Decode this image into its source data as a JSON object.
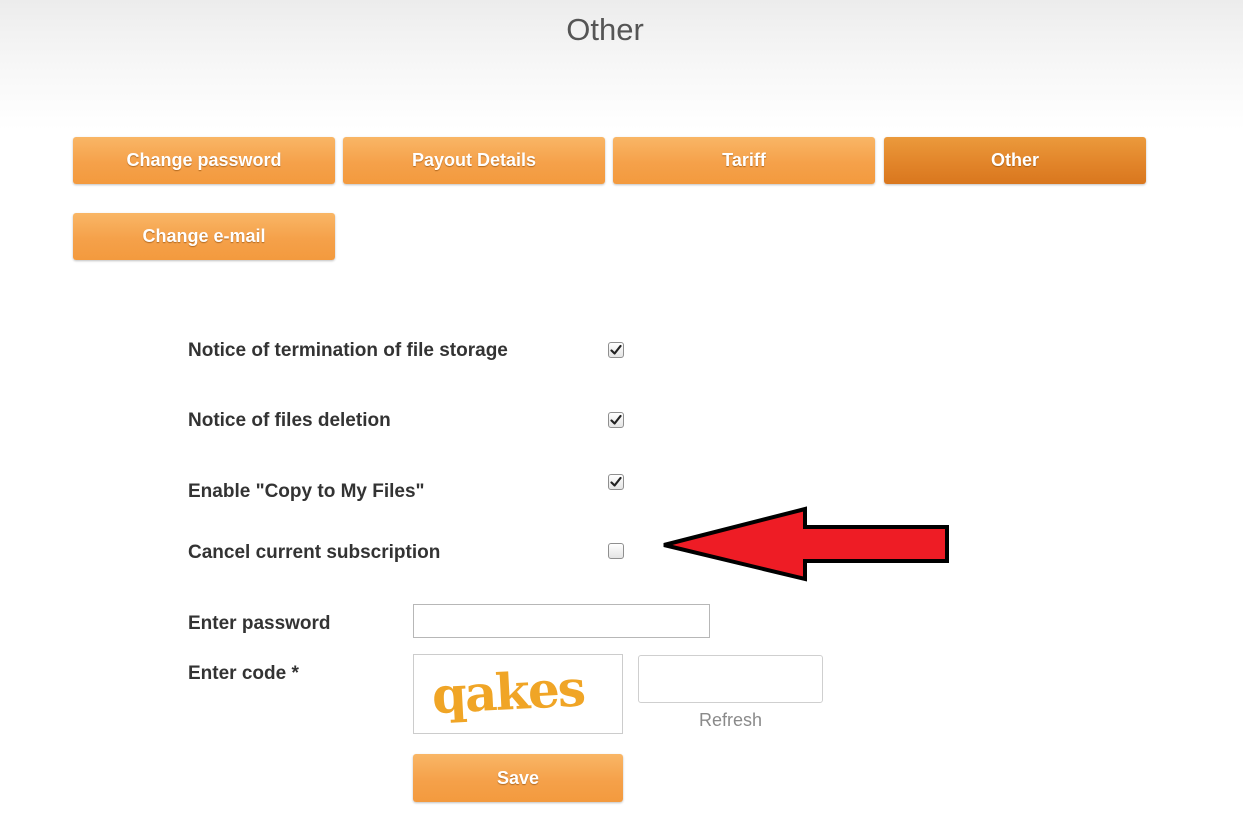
{
  "page": {
    "title": "Other"
  },
  "tabs": [
    {
      "label": "Change password",
      "active": false
    },
    {
      "label": "Payout Details",
      "active": false
    },
    {
      "label": "Tariff",
      "active": false
    },
    {
      "label": "Other",
      "active": true
    },
    {
      "label": "Change e-mail",
      "active": false
    }
  ],
  "settings": [
    {
      "label": "Notice of termination of file storage",
      "checked": true
    },
    {
      "label": "Notice of files deletion",
      "checked": true
    },
    {
      "label": "Enable \"Copy to My Files\"",
      "checked": true
    },
    {
      "label": "Cancel current subscription",
      "checked": false
    }
  ],
  "form": {
    "password_label": "Enter password",
    "password_value": "",
    "code_label": "Enter code *",
    "code_value": "",
    "captcha_text": "qakes",
    "refresh_label": "Refresh",
    "save_label": "Save"
  },
  "colors": {
    "tab": "#f5a14a",
    "tab_active": "#e2852a",
    "captcha": "#f0a526",
    "arrow": "#ee1c25"
  },
  "icons": [
    "check-icon",
    "red-arrow-icon"
  ]
}
